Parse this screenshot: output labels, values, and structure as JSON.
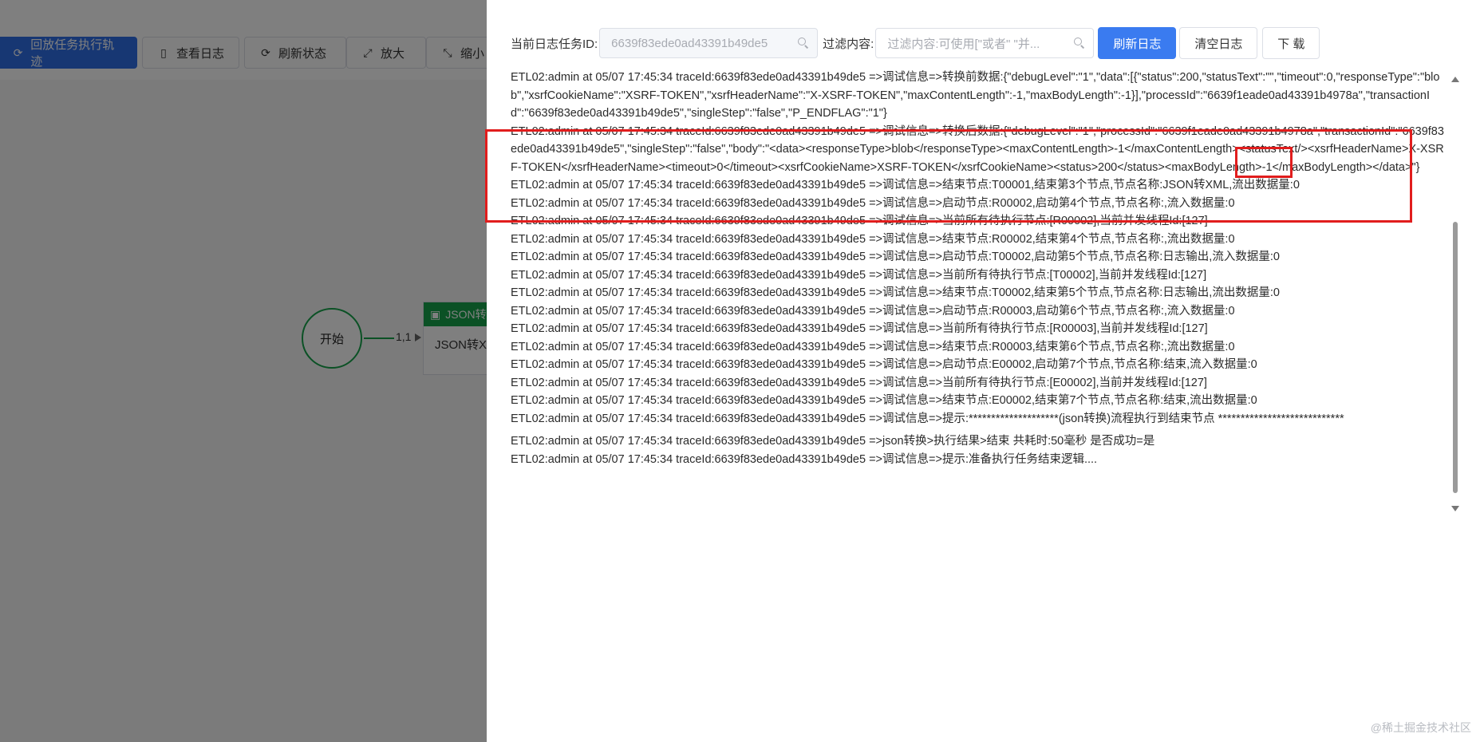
{
  "background": {
    "toolbar": {
      "replay": "回放任务执行轨迹",
      "view_log": "查看日志",
      "refresh_status": "刷新状态",
      "zoom_in": "放大",
      "zoom_out": "缩小"
    },
    "flow": {
      "start_label": "开始",
      "edge_label": "1,1",
      "node_header": "JSON转",
      "node_body": "JSON转X"
    }
  },
  "drawer": {
    "task_id_label": "当前日志任务ID:",
    "task_id_value": "6639f83ede0ad43391b49de5",
    "filter_label": "过滤内容:",
    "filter_placeholder": "过滤内容:可使用[\"或者\" \"并...",
    "buttons": {
      "refresh": "刷新日志",
      "clear": "清空日志",
      "download": "下 载"
    },
    "logs": [
      "ETL02:admin at 05/07 17:45:34 traceId:6639f83ede0ad43391b49de5 =>调试信息=>转换前数据:{\"debugLevel\":\"1\",\"data\":[{\"status\":200,\"statusText\":\"\",\"timeout\":0,\"responseType\":\"blob\",\"xsrfCookieName\":\"XSRF-TOKEN\",\"xsrfHeaderName\":\"X-XSRF-TOKEN\",\"maxContentLength\":-1,\"maxBodyLength\":-1}],\"processId\":\"6639f1eade0ad43391b4978a\",\"transactionId\":\"6639f83ede0ad43391b49de5\",\"singleStep\":\"false\",\"P_ENDFLAG\":\"1\"}",
      "ETL02:admin at 05/07 17:45:34 traceId:6639f83ede0ad43391b49de5 =>调试信息=>转换后数据:{\"debugLevel\":\"1\",\"processId\":\"6639f1eade0ad43391b4978a\",\"transactionId\":\"6639f83ede0ad43391b49de5\",\"singleStep\":\"false\",\"body\":\"<data><responseType>blob</responseType><maxContentLength>-1</maxContentLength><statusText/><xsrfHeaderName>X-XSRF-TOKEN</xsrfHeaderName><timeout>0</timeout><xsrfCookieName>XSRF-TOKEN</xsrfCookieName><status>200</status><maxBodyLength>-1</maxBodyLength></data>\"}",
      "ETL02:admin at 05/07 17:45:34 traceId:6639f83ede0ad43391b49de5 =>调试信息=>结束节点:T00001,结束第3个节点,节点名称:JSON转XML,流出数据量:0",
      "ETL02:admin at 05/07 17:45:34 traceId:6639f83ede0ad43391b49de5 =>调试信息=>启动节点:R00002,启动第4个节点,节点名称:,流入数据量:0",
      "ETL02:admin at 05/07 17:45:34 traceId:6639f83ede0ad43391b49de5 =>调试信息=>当前所有待执行节点:[R00002],当前并发线程Id:[127]",
      "ETL02:admin at 05/07 17:45:34 traceId:6639f83ede0ad43391b49de5 =>调试信息=>结束节点:R00002,结束第4个节点,节点名称:,流出数据量:0",
      "ETL02:admin at 05/07 17:45:34 traceId:6639f83ede0ad43391b49de5 =>调试信息=>启动节点:T00002,启动第5个节点,节点名称:日志输出,流入数据量:0",
      "ETL02:admin at 05/07 17:45:34 traceId:6639f83ede0ad43391b49de5 =>调试信息=>当前所有待执行节点:[T00002],当前并发线程Id:[127]",
      "ETL02:admin at 05/07 17:45:34 traceId:6639f83ede0ad43391b49de5 =>调试信息=>结束节点:T00002,结束第5个节点,节点名称:日志输出,流出数据量:0",
      "ETL02:admin at 05/07 17:45:34 traceId:6639f83ede0ad43391b49de5 =>调试信息=>启动节点:R00003,启动第6个节点,节点名称:,流入数据量:0",
      "ETL02:admin at 05/07 17:45:34 traceId:6639f83ede0ad43391b49de5 =>调试信息=>当前所有待执行节点:[R00003],当前并发线程Id:[127]",
      "ETL02:admin at 05/07 17:45:34 traceId:6639f83ede0ad43391b49de5 =>调试信息=>结束节点:R00003,结束第6个节点,节点名称:,流出数据量:0",
      "ETL02:admin at 05/07 17:45:34 traceId:6639f83ede0ad43391b49de5 =>调试信息=>启动节点:E00002,启动第7个节点,节点名称:结束,流入数据量:0",
      "ETL02:admin at 05/07 17:45:34 traceId:6639f83ede0ad43391b49de5 =>调试信息=>当前所有待执行节点:[E00002],当前并发线程Id:[127]",
      "ETL02:admin at 05/07 17:45:34 traceId:6639f83ede0ad43391b49de5 =>调试信息=>结束节点:E00002,结束第7个节点,节点名称:结束,流出数据量:0",
      "ETL02:admin at 05/07 17:45:34 traceId:6639f83ede0ad43391b49de5 =>调试信息=>提示:********************(json转换)流程执行到结束节点 ****************************",
      "ETL02:admin at 05/07 17:45:34 traceId:6639f83ede0ad43391b49de5 =>json转换>执行结果>结束 共耗时:50毫秒 是否成功=是",
      "ETL02:admin at 05/07 17:45:34 traceId:6639f83ede0ad43391b49de5 =>调试信息=>提示:准备执行任务结束逻辑...."
    ]
  },
  "watermark": "@稀土掘金技术社区"
}
